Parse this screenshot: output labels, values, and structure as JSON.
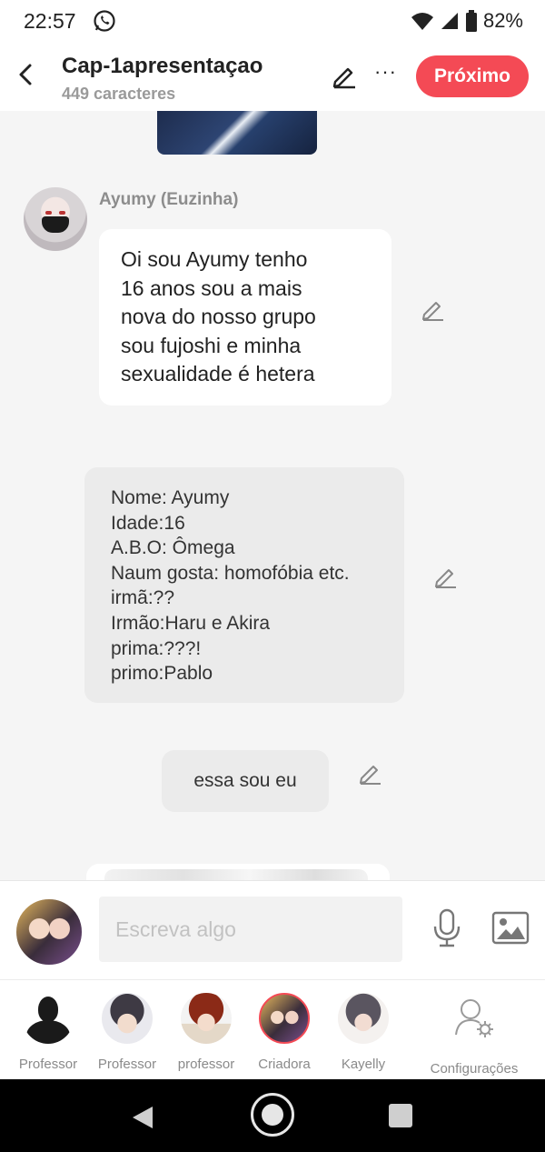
{
  "status_bar": {
    "time": "22:57",
    "battery": "82%",
    "icons": [
      "whatsapp-icon",
      "wifi-icon",
      "signal-icon",
      "battery-icon"
    ]
  },
  "header": {
    "title": "Cap-1apresentaçao",
    "subtitle": "449 caracteres",
    "next_label": "Próximo",
    "more_label": "···"
  },
  "messages": [
    {
      "sender": "Ayumy (Euzinha)",
      "lines": [
        "Oi sou Ayumy tenho",
        "16 anos sou a mais",
        "nova do nosso grupo",
        "sou fujoshi e minha",
        "sexualidade é hetera"
      ]
    },
    {
      "type": "narration",
      "lines": [
        "Nome: Ayumy",
        "Idade:16",
        "A.B.O: Ômega",
        "Naum gosta: homofóbia etc.",
        "irmã:??",
        "Irmão:Haru e Akira",
        "prima:???!",
        "primo:Pablo"
      ]
    },
    {
      "type": "narration",
      "text": "essa sou eu"
    }
  ],
  "input": {
    "placeholder": "Escreva algo"
  },
  "characters": [
    {
      "label": "Professor"
    },
    {
      "label": "Professor"
    },
    {
      "label": "professor"
    },
    {
      "label": "Criadora"
    },
    {
      "label": "Kayelly"
    }
  ],
  "settings_label": "Configurações",
  "colors": {
    "accent": "#f44a55",
    "bubble": "#ffffff",
    "narration": "#ebebeb",
    "background": "#f5f5f5"
  }
}
